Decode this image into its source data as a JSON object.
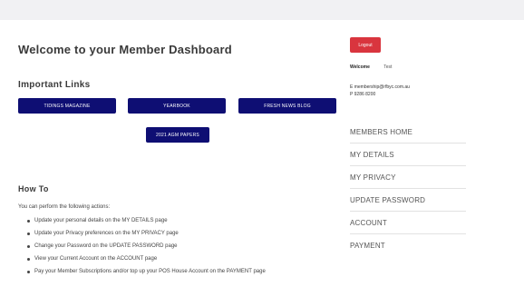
{
  "page": {
    "title": "Welcome to your Member Dashboard"
  },
  "links": {
    "heading": "Important Links",
    "buttons": [
      "TIDINGS MAGAZINE",
      "YEARBOOK",
      "FRESH NEWS BLOG",
      "2021 AGM PAPERS"
    ]
  },
  "howto": {
    "heading": "How To",
    "intro": "You can perform the following actions:",
    "items": [
      "Update your personal details on the  MY DETAILS page",
      "Update your Privacy preferences on the  MY PRIVACY page",
      "Change your Password on the UPDATE PASSWORD page",
      "View your Current Account on the ACCOUNT page",
      "Pay your  Member Subscriptions and/or top up your  POS House Account on the  PAYMENT page"
    ]
  },
  "sidebar": {
    "logout_label": "Logout",
    "welcome_label": "Welcome",
    "welcome_name": "Test",
    "email": "E membership@rfbyc.com.au",
    "phone": "P 9286 8200",
    "menu": [
      "MEMBERS HOME",
      "MY DETAILS",
      "MY PRIVACY",
      "UPDATE PASSWORD",
      "ACCOUNT",
      "PAYMENT"
    ]
  },
  "colors": {
    "nav_button": "#0e0e73",
    "logout_button": "#d9353e",
    "top_bar": "#f1f1f3"
  }
}
